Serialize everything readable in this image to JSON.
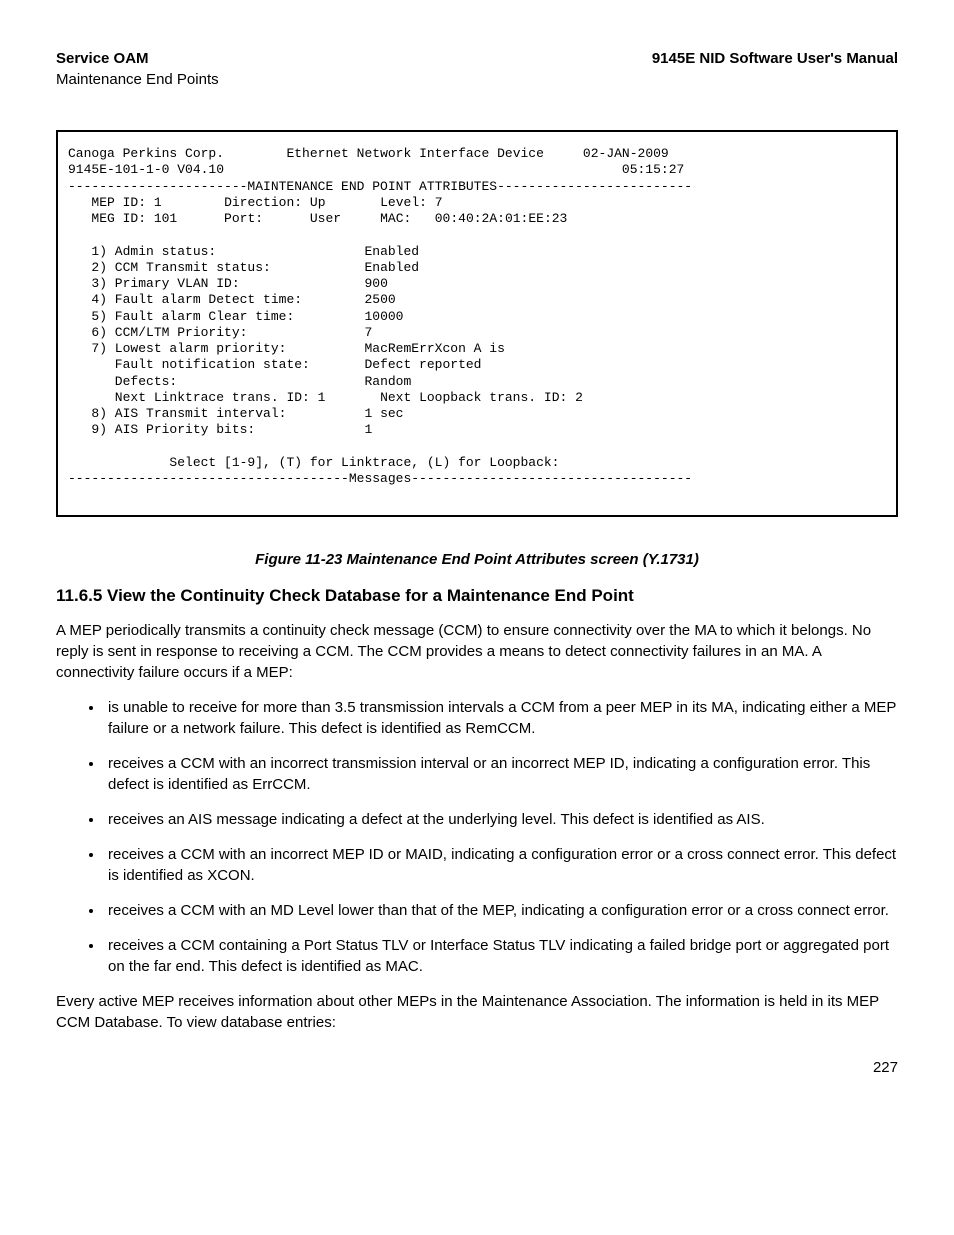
{
  "header": {
    "left_bold": "Service OAM",
    "left_sub": "Maintenance End Points",
    "right_bold": "9145E NID Software User's Manual"
  },
  "terminal": {
    "company": "Canoga Perkins Corp.",
    "device": "Ethernet Network Interface Device",
    "date": "02-JAN-2009",
    "model": "9145E-101-1-0 V04.10",
    "time": "05:15:27",
    "banner": "-----------------------MAINTENANCE END POINT ATTRIBUTES-------------------------",
    "mep_id_lbl": "MEP ID:",
    "mep_id": "1",
    "direction_lbl": "Direction:",
    "direction": "Up",
    "level_lbl": "Level:",
    "level": "7",
    "meg_id_lbl": "MEG ID:",
    "meg_id": "101",
    "port_lbl": "Port:",
    "port": "User",
    "mac_lbl": "MAC:",
    "mac": "00:40:2A:01:EE:23",
    "rows": {
      "r1_l": "1) Admin status:",
      "r1_v": "Enabled",
      "r2_l": "2) CCM Transmit status:",
      "r2_v": "Enabled",
      "r3_l": "3) Primary VLAN ID:",
      "r3_v": "900",
      "r4_l": "4) Fault alarm Detect time:",
      "r4_v": "2500",
      "r5_l": "5) Fault alarm Clear time:",
      "r5_v": "10000",
      "r6_l": "6) CCM/LTM Priority:",
      "r6_v": "7",
      "r7_l": "7) Lowest alarm priority:",
      "r7_v": "MacRemErrXcon A is",
      "r7a_l": "   Fault notification state:",
      "r7a_v": "Defect reported",
      "r7b_l": "   Defects:",
      "r7b_v": "Random",
      "r7c_l": "   Next Linktrace trans. ID: 1",
      "r7c_v": "Next Loopback trans. ID: 2",
      "r8_l": "8) AIS Transmit interval:",
      "r8_v": "1 sec",
      "r9_l": "9) AIS Priority bits:",
      "r9_v": "1"
    },
    "prompt": "Select [1-9], (T) for Linktrace, (L) for Loopback:",
    "msg_divider": "------------------------------------Messages------------------------------------"
  },
  "figure_caption": "Figure 11-23  Maintenance End Point Attributes screen (Y.1731)",
  "section_heading": "11.6.5  View the Continuity Check Database for a Maintenance End Point",
  "para1": "A MEP periodically transmits a continuity check message (CCM) to ensure connectivity over the MA to which it belongs. No reply is sent in response to receiving a CCM. The CCM provides a means to detect connectivity failures in an MA. A connectivity failure occurs if a MEP:",
  "bullets": [
    "is unable to receive for more than 3.5 transmission intervals a CCM from a peer MEP in its MA, indicating either a MEP failure or a network failure. This defect is identified as RemCCM.",
    "receives a CCM with an incorrect transmission interval or an incorrect MEP ID, indicating a configuration error. This defect is identified as ErrCCM.",
    "receives an AIS message indicating a defect at the underlying level. This defect is identified as AIS.",
    "receives a CCM with an incorrect MEP ID or MAID, indicating a configuration error or a cross connect error. This defect is identified as XCON.",
    "receives a CCM with an MD Level lower than that of the MEP, indicating a configuration error or a cross connect error.",
    "receives a CCM containing a Port Status TLV or Interface Status TLV indicating a failed bridge port or aggregated port on the far end. This defect is identified as MAC."
  ],
  "para2": "Every active MEP receives information about other MEPs in the Maintenance Association. The information is held in its MEP CCM Database. To view database entries:",
  "page_number": "227"
}
